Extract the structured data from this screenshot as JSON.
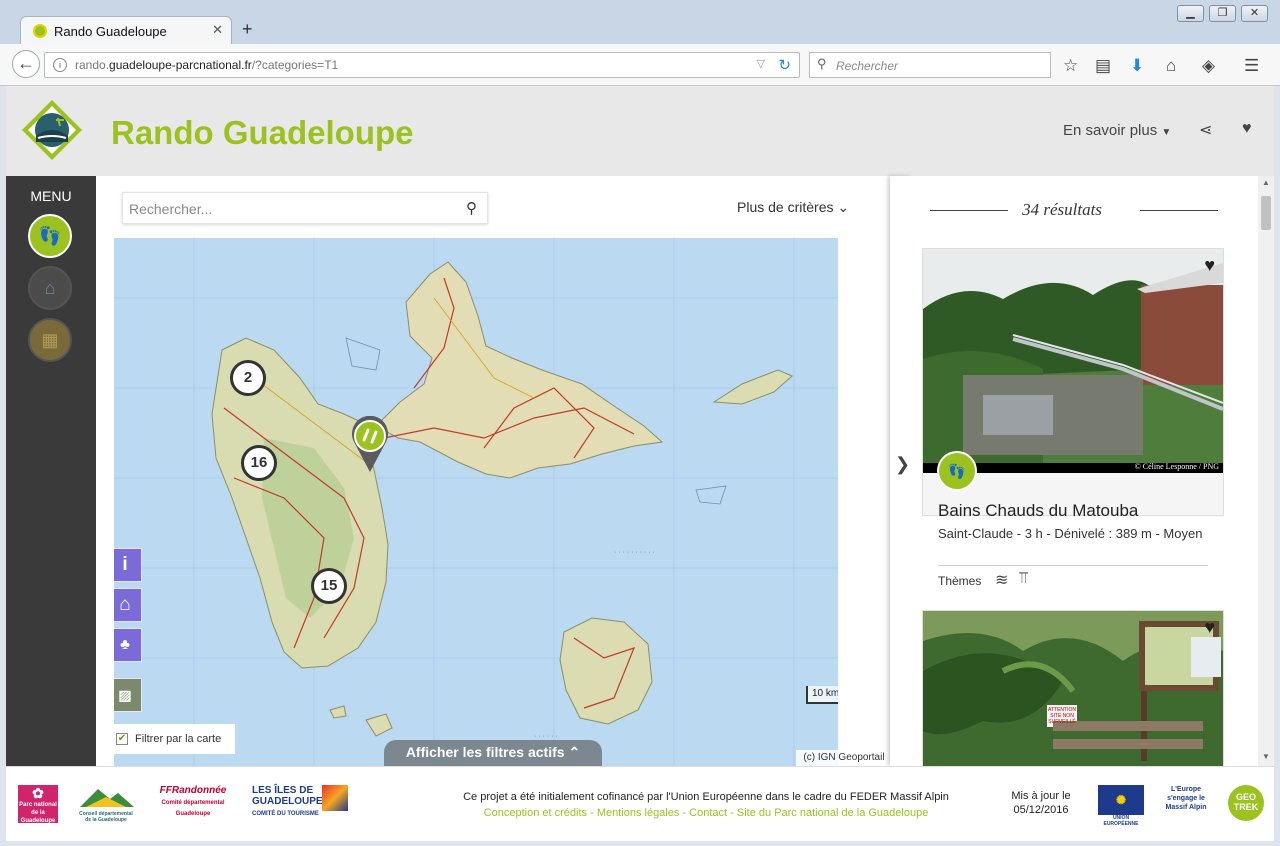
{
  "browser": {
    "tab_title": "Rando Guadeloupe",
    "url_prefix": "rando.",
    "url_domain": "guadeloupe-parcnational.fr",
    "url_path": "/?categories=T1",
    "search_placeholder": "Rechercher"
  },
  "header": {
    "site_title": "Rando Guadeloupe",
    "more_label": "En savoir plus"
  },
  "sidebar": {
    "menu_label": "MENU"
  },
  "map": {
    "search_placeholder": "Rechercher...",
    "criteria_label": "Plus de critères",
    "clusters": [
      "2",
      "16",
      "15"
    ],
    "filter_label": "Filtrer par la carte",
    "scale_label": "10 km",
    "active_filters_label": "Afficher les filtres actifs",
    "attribution": "(c) IGN Geoportail"
  },
  "results": {
    "count_label": "34 résultats",
    "cards": [
      {
        "credit": "© Céline Lesponne / PNG",
        "title": "Bains Chauds du Matouba",
        "info": "Saint-Claude  -  3 h  -  Dénivelé : 389 m  -  Moyen",
        "themes_label": "Thèmes"
      }
    ],
    "sign_text": "ATTENTION SITE NON SURVEILLÉ"
  },
  "footer": {
    "text": "Ce projet a été initialement cofinancé par l'Union Européenne dans le cadre du FEDER Massif Alpin",
    "links": [
      "Conception et crédits",
      "Mentions légales",
      "Contact",
      "Site du Parc national de la Guadeloupe"
    ],
    "update_label": "Mis à jour le",
    "update_date": "05/12/2016",
    "logos": [
      "Parc national de la Guadeloupe",
      "Conseil départemental de la Guadeloupe",
      "FFRandonnée",
      "Comité départemental Guadeloupe",
      "LES ÎLES DE GUADELOUPE",
      "COMITÉ DU TOURISME",
      "UNION EUROPÉENNE",
      "L'Europe s'engage le Massif Alpin",
      "GEO TREK"
    ]
  },
  "colors": {
    "brand": "#9bc21f",
    "panel_button": "#7b6bd8",
    "sidebar": "#3a3a3a"
  }
}
